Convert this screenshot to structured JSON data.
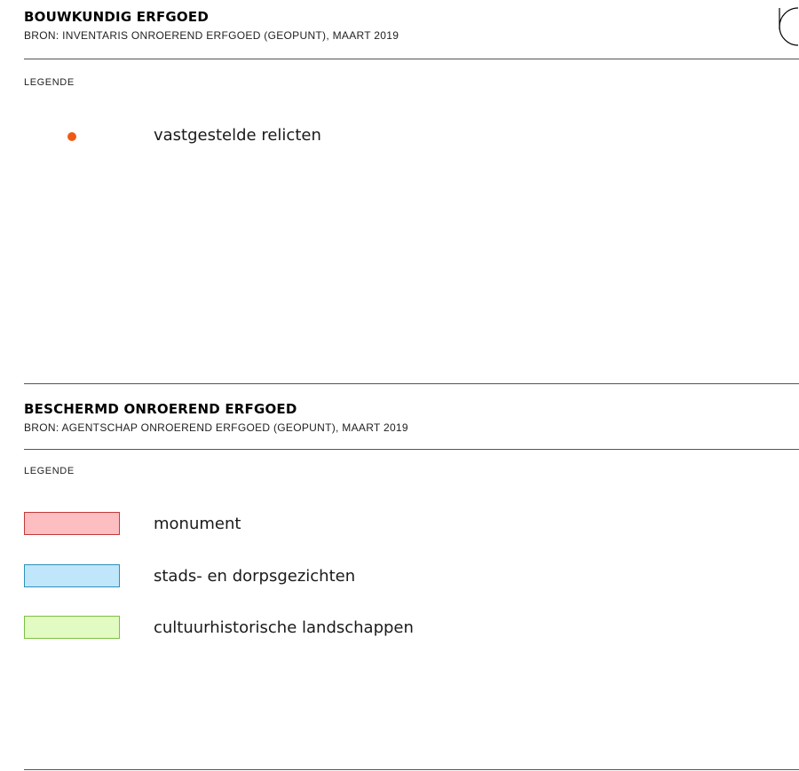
{
  "colors": {
    "relict_dot": "#ee5a14",
    "monument_fill": "#fdbec2",
    "monument_border": "#c23a3a",
    "stads_fill": "#bfe6fb",
    "stads_border": "#2f8fb8",
    "landschap_fill": "#e2fbc2",
    "landschap_border": "#7cc043"
  },
  "icons": {
    "top_right": "north-arrow-icon"
  },
  "bouwkundig": {
    "title": "BOUWKUNDIG ERFGOED",
    "source": "BRON: INVENTARIS ONROEREND ERFGOED (GEOPUNT), MAART 2019",
    "legend_heading": "LEGENDE",
    "items": [
      {
        "label": "vastgestelde relicten",
        "symbol": "dot"
      }
    ]
  },
  "beschermd": {
    "title": "BESCHERMD ONROEREND ERFGOED",
    "source": "BRON: AGENTSCHAP ONROEREND ERFGOED (GEOPUNT), MAART 2019",
    "legend_heading": "LEGENDE",
    "items": [
      {
        "label": "monument",
        "symbol": "swatch"
      },
      {
        "label": "stads- en dorpsgezichten",
        "symbol": "swatch"
      },
      {
        "label": "cultuurhistorische landschappen",
        "symbol": "swatch"
      }
    ]
  }
}
